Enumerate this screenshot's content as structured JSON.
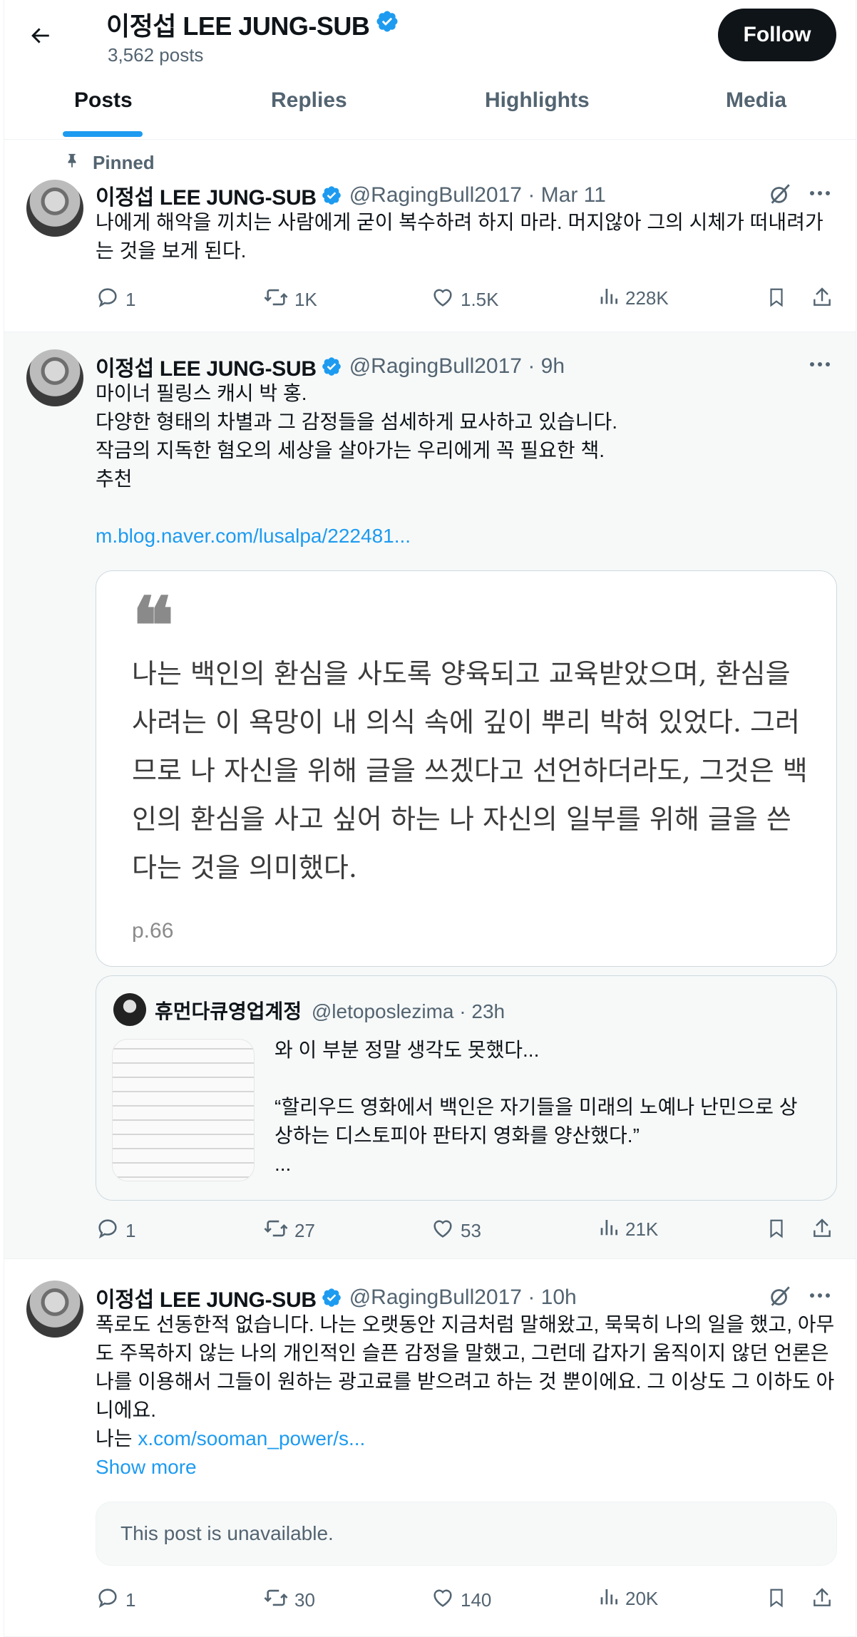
{
  "header": {
    "profile_name": "이정섭 LEE JUNG-SUB",
    "post_count": "3,562 posts",
    "follow_label": "Follow"
  },
  "tabs": [
    {
      "label": "Posts",
      "active": true
    },
    {
      "label": "Replies",
      "active": false
    },
    {
      "label": "Highlights",
      "active": false
    },
    {
      "label": "Media",
      "active": false
    }
  ],
  "posts": [
    {
      "pinned_label": "Pinned",
      "author": "이정섭 LEE JUNG-SUB",
      "handle_time": "@RagingBull2017 · Mar 11",
      "text_lines": [
        "나에게 해악을 끼치는 사람에게 굳이 복수하려 하지 마라. 머지않아 그의 시체가 떠내려가",
        "는 것을 보게 된다."
      ],
      "stats": {
        "replies": "1",
        "reposts": "1K",
        "likes": "1.5K",
        "views": "228K"
      }
    },
    {
      "author": "이정섭 LEE JUNG-SUB",
      "handle_time": "@RagingBull2017 · 9h",
      "text_lines": [
        "마이너 필링스 캐시 박 홍.",
        "다양한 형태의 차별과 그 감정들을 섬세하게 묘사하고 있습니다.",
        "작금의 지독한 혐오의 세상을 살아가는 우리에게 꼭 필요한 책.",
        "추천"
      ],
      "link": "m.blog.naver.com/lusalpa/222481...",
      "quote_image": {
        "quote_mark": "❝",
        "lines": [
          "나는 백인의 환심을 사도록 양육되고 교육받았으며, 환심을",
          "사려는 이 욕망이 내 의식 속에 깊이 뿌리 박혀 있었다. 그러",
          "므로 나 자신을 위해 글을 쓰겠다고 선언하더라도, 그것은 백",
          "인의 환심을 사고 싶어 하는 나 자신의 일부를 위해 글을 쓴",
          "다는 것을 의미했다."
        ],
        "page": "p.66"
      },
      "quoted_post": {
        "author": "휴먼다큐영업계정",
        "handle_time": "@letoposlezima · 23h",
        "lines": [
          "와 이 부분 정말 생각도 못했다...",
          "",
          "“할리우드 영화에서 백인은 자기들을 미래의 노예나 난민으로 상",
          "상하는 디스토피아 판타지 영화를 양산했다.”",
          "..."
        ]
      },
      "stats": {
        "replies": "1",
        "reposts": "27",
        "likes": "53",
        "views": "21K"
      }
    },
    {
      "author": "이정섭 LEE JUNG-SUB",
      "handle_time": "@RagingBull2017 · 10h",
      "text_lines": [
        "폭로도 선동한적 없습니다. 나는 오랫동안 지금처럼 말해왔고, 묵묵히 나의 일을 했고, 아무",
        "도 주목하지 않는 나의 개인적인 슬픈 감정을 말했고, 그런데 갑자기 움직이지 않던 언론은",
        "나를 이용해서 그들이 원하는 광고료를 받으려고 하는 것 뿐이에요. 그 이상도 그 이하도 아",
        "니에요."
      ],
      "text_prefix": "나는 ",
      "link": "x.com/sooman_power/s...",
      "show_more": "Show more",
      "unavailable": "This post is unavailable.",
      "stats": {
        "replies": "1",
        "reposts": "30",
        "likes": "140",
        "views": "20K"
      }
    }
  ],
  "colors": {
    "accent": "#1d9bf0",
    "text": "#0f1419",
    "muted": "#536471",
    "border": "#eff3f4"
  }
}
